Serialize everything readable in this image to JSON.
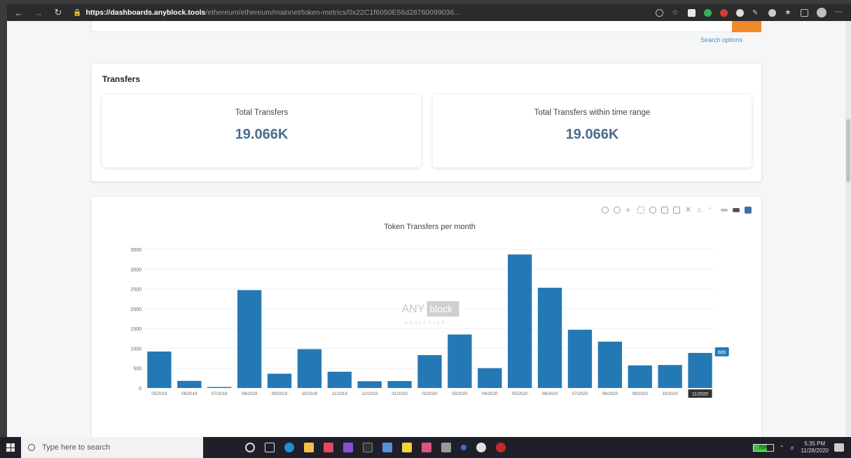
{
  "browser": {
    "url_scheme_host": "https://dashboards.anyblock.tools",
    "url_path": "/ethereum/ethereum/mainnet/token-metrics/0x22C1f6050E56d28760099036..."
  },
  "search": {
    "options_link": "Search options"
  },
  "transfers": {
    "title": "Transfers",
    "total_label": "Total Transfers",
    "total_value": "19.066K",
    "range_label": "Total Transfers within time range",
    "range_value": "19.066K"
  },
  "chart": {
    "watermark_main": "ANY",
    "watermark_box": "block",
    "watermark_sub": "ANALYTICS",
    "hover_value": "885",
    "hover_label": "11/2020"
  },
  "chart_data": {
    "type": "bar",
    "title": "Token Transfers per month",
    "xlabel": "",
    "ylabel": "",
    "categories": [
      "05/2019",
      "06/2019",
      "07/2019",
      "08/2019",
      "09/2019",
      "10/2019",
      "11/2019",
      "12/2019",
      "01/2020",
      "02/2020",
      "03/2020",
      "04/2020",
      "05/2020",
      "06/2020",
      "07/2020",
      "08/2020",
      "09/2020",
      "10/2020",
      "11/2020"
    ],
    "values": [
      920,
      180,
      25,
      2470,
      360,
      980,
      410,
      170,
      175,
      830,
      1350,
      500,
      3370,
      2530,
      1470,
      1170,
      570,
      580,
      885
    ],
    "ylim": [
      0,
      3500
    ],
    "yticks": [
      "0",
      "500",
      "1000",
      "1500",
      "2000",
      "2500",
      "3000",
      "3500"
    ],
    "bar_color": "#2479b5",
    "grid": true
  },
  "taskbar": {
    "search_placeholder": "Type here to search",
    "battery": "70%",
    "time": "5:35 PM",
    "date": "11/28/2020"
  }
}
